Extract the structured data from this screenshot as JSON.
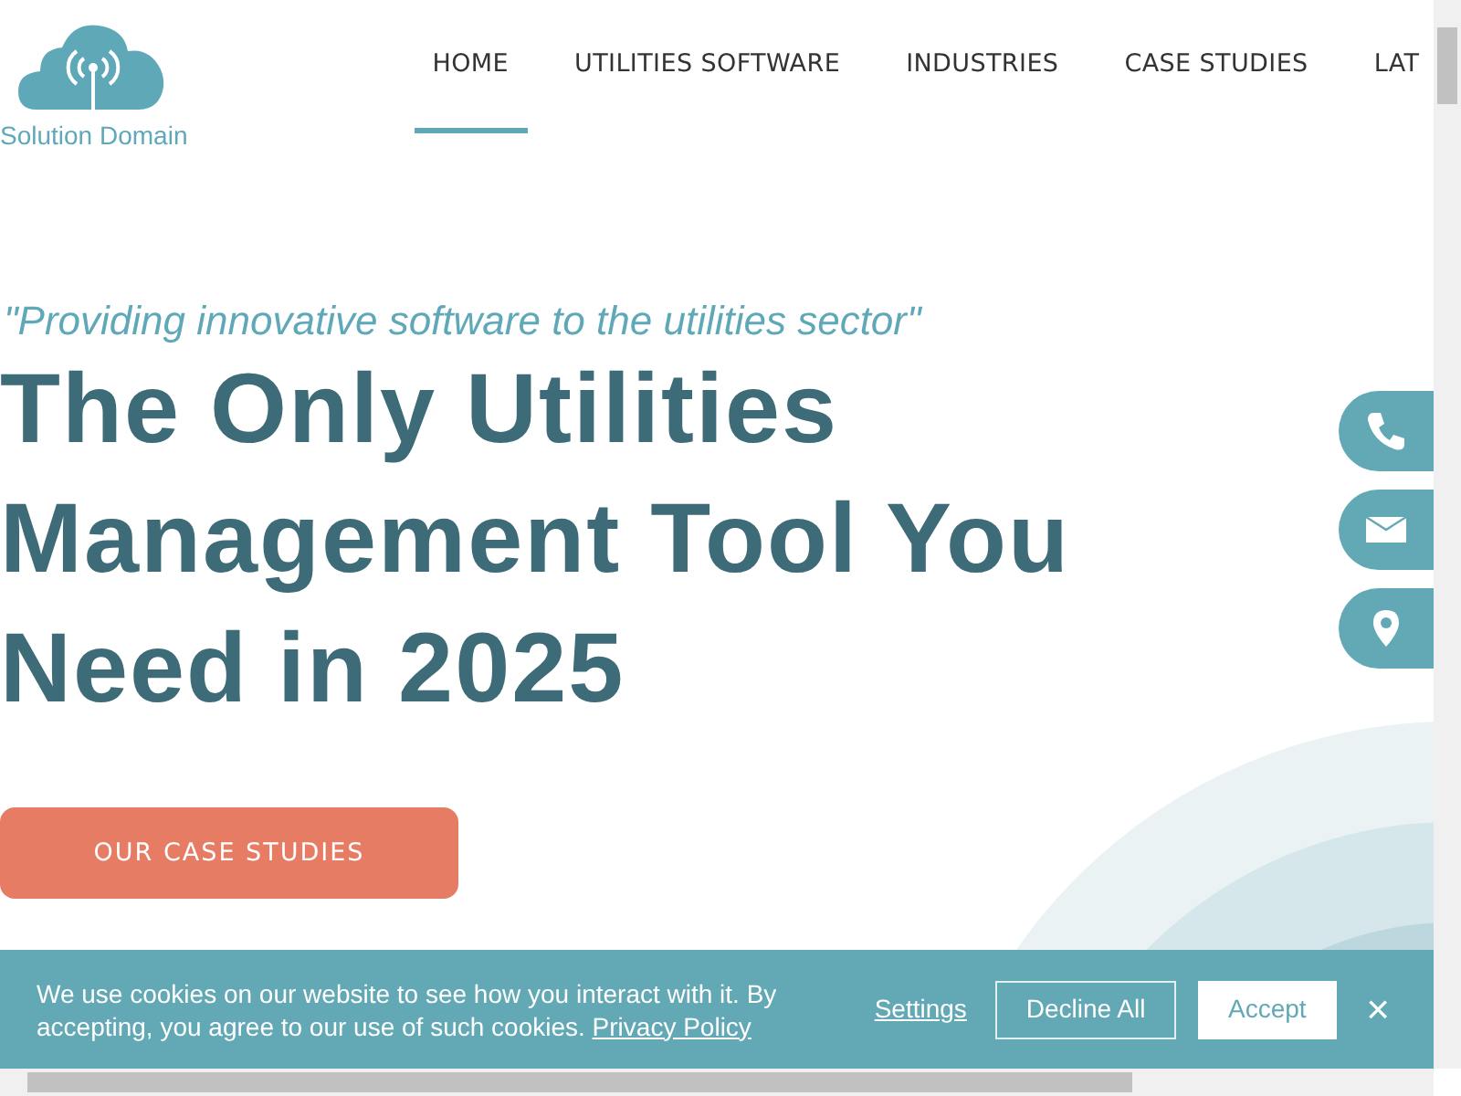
{
  "logo": {
    "text": "Solution Domain"
  },
  "nav": [
    {
      "label": "HOME",
      "selected": true
    },
    {
      "label": "UTILITIES SOFTWARE",
      "selected": false
    },
    {
      "label": "INDUSTRIES",
      "selected": false
    },
    {
      "label": "CASE STUDIES",
      "selected": false
    },
    {
      "label": "LAT",
      "selected": false
    }
  ],
  "hero": {
    "tagline": "\"Providing innovative software to the utilities sector\"",
    "heading_lines": [
      "The Only Utilities",
      "Management Tool You",
      "Need in 2025"
    ],
    "button": "OUR CASE STUDIES"
  },
  "contact_buttons": [
    {
      "kind": "phone"
    },
    {
      "kind": "email"
    },
    {
      "kind": "location"
    }
  ],
  "cookie_banner": {
    "message": "We use cookies on our website to see how you interact with it. By accepting, you agree to our use of such cookies.",
    "policy_link": "Privacy Policy",
    "settings": "Settings",
    "decline": "Decline All",
    "accept": "Accept",
    "close": "×"
  }
}
